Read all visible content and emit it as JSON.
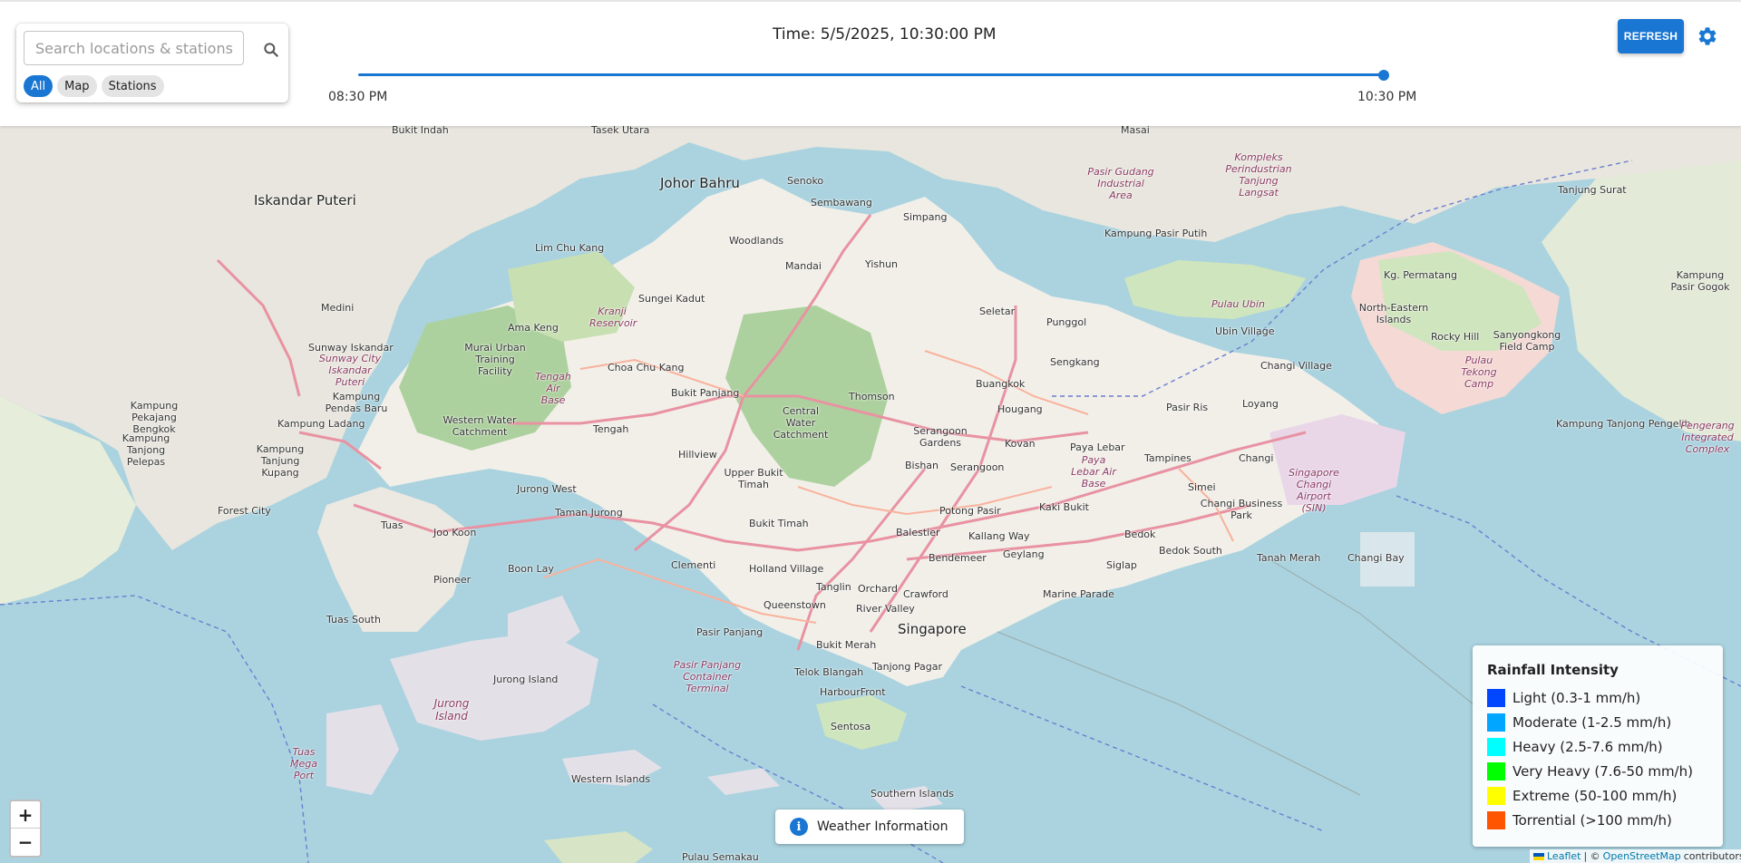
{
  "search": {
    "placeholder": "Search locations & stations",
    "filters": [
      "All",
      "Map",
      "Stations"
    ],
    "active_filter": "All"
  },
  "timeline": {
    "time_label": "Time: 5/5/2025, 10:30:00 PM",
    "start_label": "08:30 PM",
    "end_label": "10:30 PM",
    "position_fraction": 1.0
  },
  "toolbar": {
    "refresh_label": "REFRESH",
    "settings_icon": "gear-icon",
    "search_icon": "search-icon"
  },
  "map": {
    "zoom_in": "+",
    "zoom_out": "−",
    "labels": {
      "iskandar_puteri": "Iskandar Puteri",
      "johor_bahru": "Johor Bahru",
      "senoko": "Senoko",
      "sembawang": "Sembawang",
      "simpang": "Simpang",
      "woodlands": "Woodlands",
      "mandai": "Mandai",
      "yishun": "Yishun",
      "lim_chu_kang": "Lim Chu Kang",
      "sungei_kadut": "Sungei Kadut",
      "seletar": "Seletar",
      "punggol": "Punggol",
      "sengkang": "Sengkang",
      "buangkok": "Buangkok",
      "hougang": "Hougang",
      "ama_keng": "Ama Keng",
      "choa_chu_kang": "Choa Chu Kang",
      "bukit_panjang": "Bukit Panjang",
      "thomson": "Thomson",
      "central_water_catchment": "Central Water Catchment",
      "tengah": "Tengah",
      "western_water_catchment": "Western Water Catchment",
      "hillview": "Hillview",
      "upper_bukit_timah": "Upper Bukit Timah",
      "serangoon_gardens": "Serangoon Gardens",
      "kovan": "Kovan",
      "paya_lebar": "Paya Lebar",
      "tampines": "Tampines",
      "pasir_ris": "Pasir Ris",
      "loyang": "Loyang",
      "changi_village": "Changi Village",
      "changi": "Changi",
      "jurong_west": "Jurong West",
      "taman_jurong": "Taman Jurong",
      "bukit_timah": "Bukit Timah",
      "bishan": "Bishan",
      "serangoon": "Serangoon",
      "simei": "Simei",
      "changi_business_park": "Changi Business Park",
      "tuas": "Tuas",
      "joo_koon": "Joo Koon",
      "pioneer": "Pioneer",
      "boon_lay": "Boon Lay",
      "clementi": "Clementi",
      "holland_village": "Holland Village",
      "potong_pasir": "Potong Pasir",
      "kaki_bukit": "Kaki Bukit",
      "bedok": "Bedok",
      "bedok_south": "Bedok South",
      "tanah_merah": "Tanah Merah",
      "changi_bay": "Changi Bay",
      "balestier": "Balestier",
      "kallang_way": "Kallang Way",
      "geylang": "Geylang",
      "bendemeer": "Bendemeer",
      "siglap": "Siglap",
      "tanglin": "Tanglin",
      "orchard": "Orchard",
      "crawford": "Crawford",
      "marine_parade": "Marine Parade",
      "queenstown": "Queenstown",
      "river_valley": "River Valley",
      "singapore": "Singapore",
      "tuas_south": "Tuas South",
      "pasir_panjang": "Pasir Panjang",
      "bukit_merah": "Bukit Merah",
      "tanjong_pagar": "Tanjong Pagar",
      "telok_blangah": "Telok Blangah",
      "harbourfront": "HarbourFront",
      "sentosa": "Sentosa",
      "jurong_island_small": "Jurong Island",
      "jurong_island": "Jurong Island",
      "western_islands": "Western Islands",
      "southern_islands": "Southern Islands",
      "forest_city": "Forest City",
      "medini": "Medini",
      "sunway_iskandar": "Sunway Iskandar",
      "kampung_pendas_baru": "Kampung Pendas Baru",
      "kampung_ladang": "Kampung Ladang",
      "kampung_pekajang_bengkok": "Kampung Pekajang Bengkok",
      "kampung_tanjong_pelepas": "Kampung Tanjong Pelepas",
      "kampung_tanjung_kupang": "Kampung Tanjung Kupang",
      "tanjung_surat": "Tanjung Surat",
      "kampung_pasir_putih": "Kampung Pasir Putih",
      "pulau_ubin": "Pulau Ubin",
      "ubin_village": "Ubin Village",
      "kg_permatang": "Kg. Permatang",
      "north_eastern_islands": "North-Eastern Islands",
      "rocky_hill": "Rocky Hill",
      "sanyongkong_field_camp": "Sanyongkong Field Camp",
      "pulau_tekong_camp": "Pulau Tekong Camp",
      "kampung_pasir_gogok": "Kampung Pasir Gogok",
      "kampung_tanjong_pengelih": "Kampung Tanjong Pengelih",
      "tasek_utara": "Tasek Utara",
      "bukit_indah": "Bukit Indah",
      "masai": "Masai",
      "pengerang": "Pengerang Integrated Complex",
      "pasir_gudang": "Pasir Gudang Industrial Area",
      "kompleks": "Kompleks Perindustrian Tanjung Langsat",
      "tengah_air_base": "Tengah Air Base",
      "murai_training": "Murai Urban Training Facility",
      "kranji_reservoir": "Kranji Reservoir",
      "paya_lebar_air_base": "Paya Lebar Air Base",
      "changi_airport": "Singapore Changi Airport (SIN)",
      "pasir_panjang_terminal": "Pasir Panjang Container Terminal",
      "tuas_mega_port": "Tuas Mega Port",
      "pulau_semakau": "Pulau Semakau",
      "sunway_city": "Sunway City Iskandar Puteri"
    }
  },
  "weather_info": {
    "label": "Weather Information"
  },
  "legend": {
    "title": "Rainfall Intensity",
    "items": [
      {
        "label": "Light (0.3-1 mm/h)",
        "color": "#0047ff"
      },
      {
        "label": "Moderate (1-2.5 mm/h)",
        "color": "#00a6ff"
      },
      {
        "label": "Heavy (2.5-7.6 mm/h)",
        "color": "#00ffff"
      },
      {
        "label": "Very Heavy (7.6-50 mm/h)",
        "color": "#00ff00"
      },
      {
        "label": "Extreme (50-100 mm/h)",
        "color": "#ffff00"
      },
      {
        "label": "Torrential (>100 mm/h)",
        "color": "#ff5500"
      }
    ]
  },
  "attribution": {
    "leaflet": "Leaflet",
    "sep": "| ©",
    "osm": "OpenStreetMap",
    "contributors": "contributors"
  },
  "colors": {
    "accent": "#1976d2",
    "sea": "#aad3df",
    "land": "#f2efe9"
  }
}
